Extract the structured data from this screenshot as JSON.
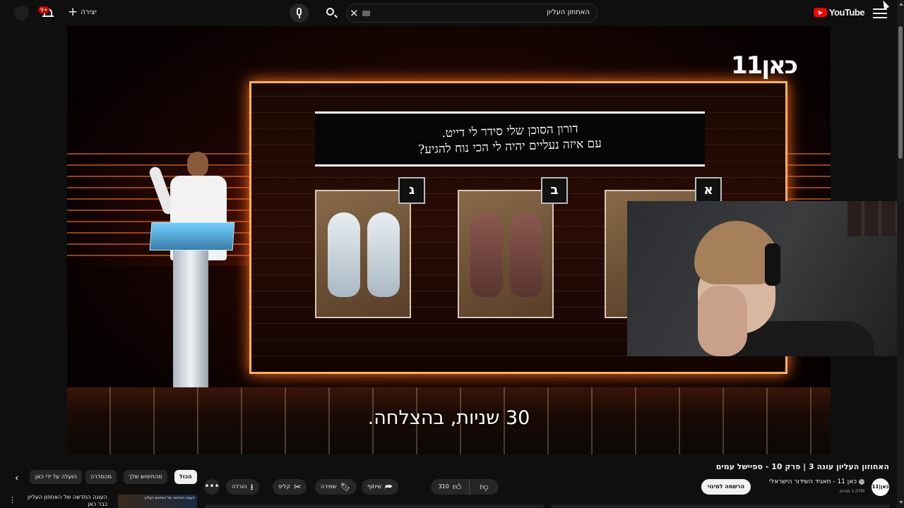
{
  "topbar": {
    "logo_text": "YouTube",
    "search_value": "האחוזון העליון",
    "create_label": "יצירה",
    "notification_count": "9+"
  },
  "video": {
    "question_line1": "דורון הסוכן שלי סידר לי דייט.",
    "question_line2": "עם איזה נעליים יהיה לי הכי נוח להגיע?",
    "options": [
      "ג",
      "ב",
      "א"
    ],
    "broadcaster_logo": "כאן11",
    "subtitle": "30 שניות, בהצלחה."
  },
  "info": {
    "title": "האחוזון העליון עונה 3 | פרק 10 - ספיישל עמים",
    "channel_avatar_text": "כאן|11",
    "channel_name": "כאן 11 - תאגיד השידור הישראלי",
    "subscribers": "1.07M מנויים",
    "subscribe_label": "הרשמה למינוי",
    "like_count": "310",
    "share_label": "שיתוף",
    "save_label": "שמירה",
    "clip_label": "קליפ",
    "download_label": "הורדה",
    "more_label": "•••"
  },
  "chips": [
    "הכול",
    "מהחיפוש שלך",
    "מהסדרה",
    "הועלה על ידי כאן"
  ],
  "recommendation": {
    "thumb_text": "העונה החדשה של האחוזון העליון",
    "title": "העונה החדשה של האחוזון העליון כבר כאן"
  },
  "colors": {
    "accent": "#ff0000",
    "background": "#0f0f0f",
    "board_border": "#ffb060"
  }
}
